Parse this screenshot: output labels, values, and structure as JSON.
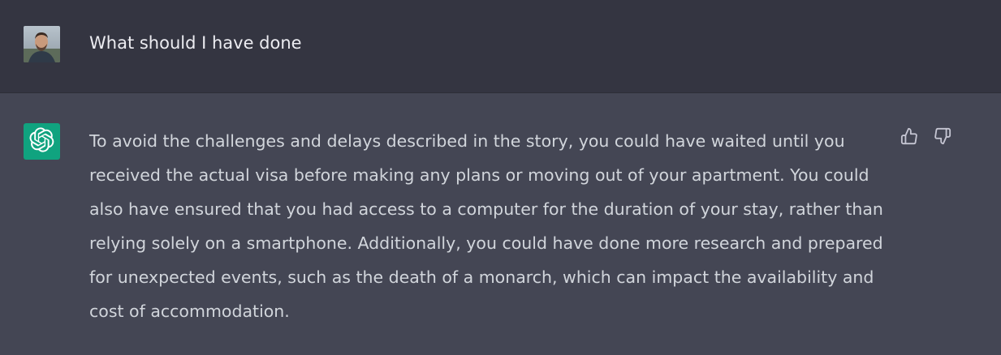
{
  "user_message": {
    "text": "What should I have done",
    "avatar_icon": "user-avatar-photo"
  },
  "assistant_message": {
    "avatar_icon": "openai-logo-icon",
    "avatar_color": "#10a37f",
    "text": "To avoid the challenges and delays described in the story, you could have waited until you received the actual visa before making any plans or moving out of your apartment. You could also have ensured that you had access to a computer for the duration of your stay, rather than relying solely on a smartphone. Additionally, you could have done more research and prepared for unexpected events, such as the death of a monarch, which can impact the availability and cost of accommodation."
  },
  "feedback": {
    "thumbs_up_icon": "thumbs-up-icon",
    "thumbs_down_icon": "thumbs-down-icon"
  },
  "colors": {
    "user_row_bg": "#343541",
    "assistant_row_bg": "#444654",
    "user_text": "#ececf1",
    "assistant_text": "#d1d5db",
    "icon": "#c5c5d2"
  }
}
